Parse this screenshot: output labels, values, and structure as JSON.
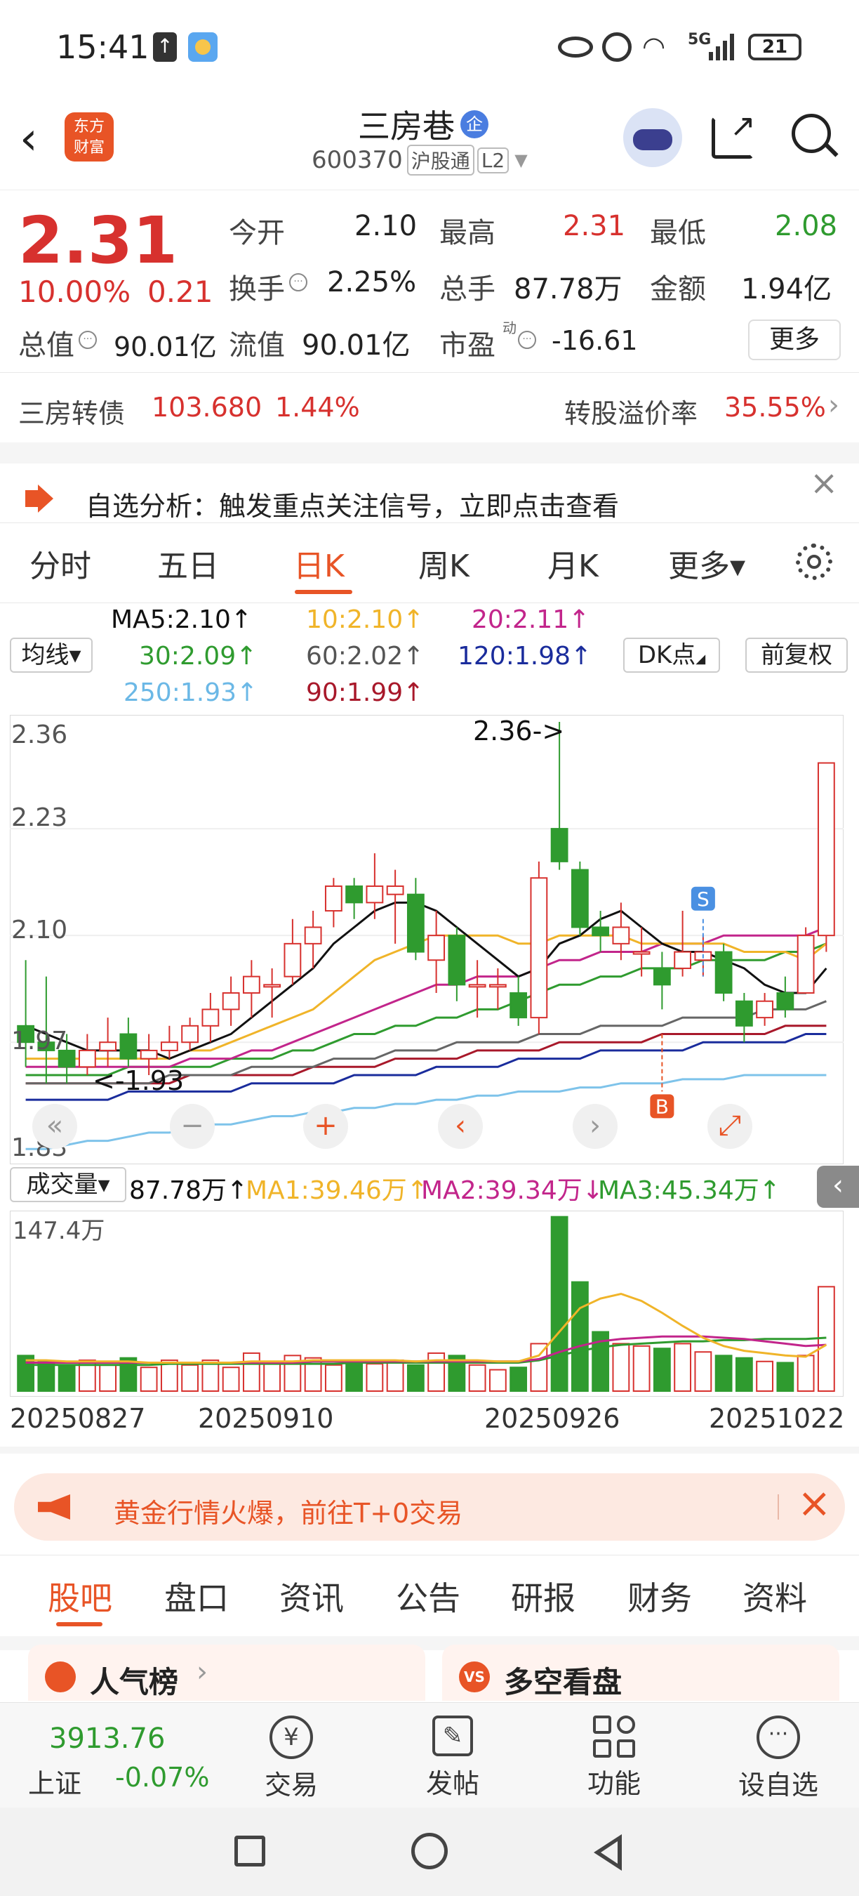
{
  "status_bar": {
    "time": "15:41",
    "battery": "21",
    "network": "5G"
  },
  "header": {
    "title": "三房巷",
    "badge": "企",
    "code": "600370",
    "exchange": "沪股通",
    "level": "L2",
    "logo_line1": "东方",
    "logo_line2": "财富"
  },
  "quote": {
    "price": "2.31",
    "change_pct": "10.00%",
    "change": "0.21",
    "open_label": "今开",
    "open": "2.10",
    "high_label": "最高",
    "high": "2.31",
    "low_label": "最低",
    "low": "2.08",
    "turnover_label": "换手",
    "turnover": "2.25%",
    "volume_label": "总手",
    "volume": "87.78万",
    "amount_label": "金额",
    "amount": "1.94亿",
    "mcap_label": "总值",
    "mcap": "90.01亿",
    "float_label": "流值",
    "float": "90.01亿",
    "pe_label": "市盈",
    "pe_sup": "动",
    "pe": "-16.61",
    "more_label": "更多"
  },
  "bond": {
    "name": "三房转债",
    "price": "103.680",
    "pct": "1.44%",
    "premium_label": "转股溢价率",
    "premium": "35.55%"
  },
  "notice": {
    "text": "自选分析：触发重点关注信号，立即点击查看"
  },
  "tabs": {
    "t1": "分时",
    "t2": "五日",
    "t3": "日K",
    "t4": "周K",
    "t5": "月K",
    "t6": "更多▾"
  },
  "ma": {
    "selector": "均线▾",
    "ma5": "MA5:2.10↑",
    "ma10": "10:2.10↑",
    "ma20": "20:2.11↑",
    "ma30": "30:2.09↑",
    "ma60": "60:2.02↑",
    "ma120": "120:1.98↑",
    "ma250": "250:1.93↑",
    "ma90": "90:1.99↑",
    "dk": "DK点",
    "adjust": "前复权"
  },
  "colors": {
    "up": "#d7312e",
    "down": "#2f9b2f",
    "ma5": "#111111",
    "ma10": "#f0b429",
    "ma20": "#c2258b",
    "ma30": "#2f9b2f",
    "ma60": "#666666",
    "ma120": "#1a2c9c",
    "ma250": "#7ec3ea",
    "ma90": "#a8182a"
  },
  "chart_labels": {
    "y_top": "2.36",
    "y_2": "2.23",
    "y_3": "2.10",
    "y_4": "1.97",
    "y_bottom": "1.83",
    "high_marker": "2.36->",
    "low_marker": "<-1.93",
    "signal_s": "S",
    "signal_b": "B"
  },
  "volume": {
    "selector": "成交量▾",
    "value": "87.78万↑",
    "ma1": "MA1:39.46万↑",
    "ma2": "MA2:39.34万↓",
    "ma3": "MA3:45.34万↑",
    "y_top": "147.4万",
    "dates": [
      "20250827",
      "20250910",
      "20250926",
      "20251022"
    ]
  },
  "chart_data": {
    "type": "candlestick",
    "title": "",
    "ylim": [
      1.83,
      2.36
    ],
    "candles": [
      {
        "o": 1.99,
        "c": 1.97,
        "h": 2.07,
        "l": 1.94
      },
      {
        "o": 1.97,
        "c": 1.96,
        "h": 2.05,
        "l": 1.92
      },
      {
        "o": 1.96,
        "c": 1.94,
        "h": 1.98,
        "l": 1.92
      },
      {
        "o": 1.94,
        "c": 1.96,
        "h": 1.98,
        "l": 1.93
      },
      {
        "o": 1.96,
        "c": 1.97,
        "h": 2.0,
        "l": 1.94
      },
      {
        "o": 1.98,
        "c": 1.95,
        "h": 2.0,
        "l": 1.94
      },
      {
        "o": 1.95,
        "c": 1.96,
        "h": 1.98,
        "l": 1.93
      },
      {
        "o": 1.96,
        "c": 1.97,
        "h": 1.99,
        "l": 1.95
      },
      {
        "o": 1.97,
        "c": 1.99,
        "h": 2.0,
        "l": 1.96
      },
      {
        "o": 1.99,
        "c": 2.01,
        "h": 2.03,
        "l": 1.97
      },
      {
        "o": 2.01,
        "c": 2.03,
        "h": 2.05,
        "l": 1.99
      },
      {
        "o": 2.03,
        "c": 2.05,
        "h": 2.07,
        "l": 2.0
      },
      {
        "o": 2.04,
        "c": 2.04,
        "h": 2.06,
        "l": 2.0
      },
      {
        "o": 2.05,
        "c": 2.09,
        "h": 2.12,
        "l": 2.04
      },
      {
        "o": 2.09,
        "c": 2.11,
        "h": 2.13,
        "l": 2.06
      },
      {
        "o": 2.13,
        "c": 2.16,
        "h": 2.17,
        "l": 2.11
      },
      {
        "o": 2.16,
        "c": 2.14,
        "h": 2.17,
        "l": 2.12
      },
      {
        "o": 2.14,
        "c": 2.16,
        "h": 2.2,
        "l": 2.12
      },
      {
        "o": 2.15,
        "c": 2.16,
        "h": 2.18,
        "l": 2.09
      },
      {
        "o": 2.15,
        "c": 2.08,
        "h": 2.17,
        "l": 2.07
      },
      {
        "o": 2.07,
        "c": 2.1,
        "h": 2.13,
        "l": 2.03
      },
      {
        "o": 2.1,
        "c": 2.04,
        "h": 2.11,
        "l": 2.02
      },
      {
        "o": 2.04,
        "c": 2.04,
        "h": 2.07,
        "l": 2.0
      },
      {
        "o": 2.04,
        "c": 2.04,
        "h": 2.06,
        "l": 2.01
      },
      {
        "o": 2.03,
        "c": 2.0,
        "h": 2.05,
        "l": 1.99
      },
      {
        "o": 2.0,
        "c": 2.17,
        "h": 2.19,
        "l": 1.98
      },
      {
        "o": 2.23,
        "c": 2.19,
        "h": 2.36,
        "l": 2.18
      },
      {
        "o": 2.18,
        "c": 2.11,
        "h": 2.19,
        "l": 2.1
      },
      {
        "o": 2.11,
        "c": 2.1,
        "h": 2.13,
        "l": 2.08
      },
      {
        "o": 2.09,
        "c": 2.11,
        "h": 2.14,
        "l": 2.07
      },
      {
        "o": 2.08,
        "c": 2.08,
        "h": 2.11,
        "l": 2.05
      },
      {
        "o": 2.06,
        "c": 2.04,
        "h": 2.08,
        "l": 2.01
      },
      {
        "o": 2.06,
        "c": 2.08,
        "h": 2.13,
        "l": 2.05
      },
      {
        "o": 2.07,
        "c": 2.08,
        "h": 2.1,
        "l": 2.05
      },
      {
        "o": 2.08,
        "c": 2.03,
        "h": 2.09,
        "l": 2.02
      },
      {
        "o": 2.02,
        "c": 1.99,
        "h": 2.03,
        "l": 1.97
      },
      {
        "o": 2.0,
        "c": 2.02,
        "h": 2.03,
        "l": 1.99
      },
      {
        "o": 2.03,
        "c": 2.01,
        "h": 2.05,
        "l": 2.0
      },
      {
        "o": 2.03,
        "c": 2.1,
        "h": 2.11,
        "l": 2.03
      },
      {
        "o": 2.1,
        "c": 2.31,
        "h": 2.31,
        "l": 2.08
      }
    ],
    "ma5": [
      1.99,
      1.98,
      1.97,
      1.96,
      1.96,
      1.96,
      1.96,
      1.95,
      1.96,
      1.97,
      1.98,
      2.0,
      2.02,
      2.04,
      2.06,
      2.09,
      2.11,
      2.13,
      2.14,
      2.14,
      2.13,
      2.11,
      2.09,
      2.07,
      2.05,
      2.06,
      2.09,
      2.1,
      2.12,
      2.13,
      2.11,
      2.09,
      2.08,
      2.08,
      2.07,
      2.06,
      2.04,
      2.03,
      2.03,
      2.06
    ],
    "ma10": [
      1.95,
      1.95,
      1.95,
      1.95,
      1.95,
      1.95,
      1.95,
      1.95,
      1.96,
      1.96,
      1.97,
      1.98,
      1.99,
      2.0,
      2.01,
      2.03,
      2.05,
      2.07,
      2.08,
      2.09,
      2.1,
      2.1,
      2.1,
      2.1,
      2.09,
      2.09,
      2.1,
      2.1,
      2.1,
      2.1,
      2.09,
      2.09,
      2.09,
      2.09,
      2.09,
      2.08,
      2.08,
      2.08,
      2.07,
      2.09
    ],
    "ma20": [
      1.94,
      1.94,
      1.94,
      1.94,
      1.94,
      1.94,
      1.94,
      1.94,
      1.95,
      1.95,
      1.95,
      1.96,
      1.96,
      1.97,
      1.98,
      1.99,
      2.0,
      2.01,
      2.02,
      2.03,
      2.04,
      2.04,
      2.05,
      2.05,
      2.05,
      2.06,
      2.07,
      2.07,
      2.08,
      2.08,
      2.08,
      2.09,
      2.09,
      2.09,
      2.1,
      2.1,
      2.1,
      2.1,
      2.1,
      2.11
    ],
    "ma30": [
      1.93,
      1.93,
      1.93,
      1.93,
      1.93,
      1.94,
      1.94,
      1.94,
      1.94,
      1.94,
      1.95,
      1.95,
      1.95,
      1.96,
      1.96,
      1.97,
      1.98,
      1.98,
      1.99,
      1.99,
      2.0,
      2.0,
      2.01,
      2.01,
      2.02,
      2.03,
      2.04,
      2.04,
      2.05,
      2.05,
      2.06,
      2.06,
      2.06,
      2.07,
      2.07,
      2.07,
      2.07,
      2.08,
      2.08,
      2.09
    ],
    "ma60": [
      1.92,
      1.92,
      1.92,
      1.92,
      1.92,
      1.92,
      1.92,
      1.93,
      1.93,
      1.93,
      1.93,
      1.94,
      1.94,
      1.94,
      1.94,
      1.95,
      1.95,
      1.95,
      1.96,
      1.96,
      1.96,
      1.97,
      1.97,
      1.97,
      1.97,
      1.98,
      1.98,
      1.98,
      1.99,
      1.99,
      1.99,
      1.99,
      2.0,
      2.0,
      2.0,
      2.0,
      2.01,
      2.01,
      2.01,
      2.02
    ],
    "ma90": [
      1.92,
      1.92,
      1.92,
      1.92,
      1.92,
      1.92,
      1.92,
      1.92,
      1.93,
      1.93,
      1.93,
      1.93,
      1.93,
      1.93,
      1.94,
      1.94,
      1.94,
      1.94,
      1.95,
      1.95,
      1.95,
      1.95,
      1.96,
      1.96,
      1.96,
      1.96,
      1.97,
      1.97,
      1.97,
      1.97,
      1.97,
      1.98,
      1.98,
      1.98,
      1.98,
      1.98,
      1.98,
      1.99,
      1.99,
      1.99
    ],
    "ma120": [
      1.9,
      1.9,
      1.9,
      1.9,
      1.9,
      1.91,
      1.91,
      1.91,
      1.91,
      1.91,
      1.91,
      1.92,
      1.92,
      1.92,
      1.92,
      1.92,
      1.93,
      1.93,
      1.93,
      1.93,
      1.94,
      1.94,
      1.94,
      1.94,
      1.95,
      1.95,
      1.95,
      1.95,
      1.96,
      1.96,
      1.96,
      1.96,
      1.96,
      1.97,
      1.97,
      1.97,
      1.97,
      1.97,
      1.98,
      1.98
    ],
    "ma250": [
      1.84,
      1.84,
      1.845,
      1.85,
      1.85,
      1.855,
      1.86,
      1.86,
      1.865,
      1.87,
      1.87,
      1.875,
      1.88,
      1.88,
      1.885,
      1.885,
      1.89,
      1.89,
      1.895,
      1.895,
      1.9,
      1.9,
      1.905,
      1.905,
      1.91,
      1.91,
      1.91,
      1.915,
      1.915,
      1.92,
      1.92,
      1.92,
      1.925,
      1.925,
      1.925,
      1.93,
      1.93,
      1.93,
      1.93,
      1.93
    ],
    "volumes": [
      30,
      25,
      22,
      26,
      22,
      28,
      20,
      26,
      22,
      26,
      20,
      32,
      24,
      30,
      28,
      22,
      26,
      23,
      26,
      22,
      32,
      30,
      22,
      18,
      20,
      40,
      147,
      92,
      50,
      40,
      38,
      36,
      40,
      33,
      30,
      28,
      25,
      24,
      30,
      88
    ],
    "vol_ylim": [
      0,
      147.4
    ],
    "vol_ma1": [
      26,
      26,
      25,
      25,
      25,
      25,
      24,
      24,
      24,
      24,
      24,
      25,
      25,
      25,
      26,
      26,
      26,
      26,
      26,
      25,
      26,
      26,
      26,
      25,
      25,
      30,
      50,
      70,
      78,
      82,
      76,
      66,
      55,
      45,
      38,
      34,
      32,
      30,
      29,
      39
    ],
    "vol_ma2": [
      24,
      24,
      24,
      24,
      24,
      24,
      24,
      24,
      24,
      24,
      24,
      24,
      24,
      24,
      25,
      25,
      25,
      25,
      25,
      25,
      25,
      25,
      25,
      25,
      25,
      27,
      33,
      38,
      42,
      44,
      45,
      46,
      46,
      46,
      45,
      44,
      42,
      40,
      38,
      39
    ],
    "vol_ma3": [
      22,
      22,
      22,
      22,
      22,
      22,
      22,
      23,
      23,
      23,
      23,
      23,
      23,
      23,
      23,
      23,
      24,
      24,
      24,
      24,
      24,
      24,
      24,
      24,
      24,
      26,
      30,
      34,
      37,
      39,
      40,
      41,
      42,
      42,
      43,
      43,
      44,
      44,
      44,
      45
    ]
  },
  "ad": {
    "text": "黄金行情火爆，前往T+0交易"
  },
  "section_tabs": {
    "s1": "股吧",
    "s2": "盘口",
    "s3": "资讯",
    "s4": "公告",
    "s5": "研报",
    "s6": "财务",
    "s7": "资料"
  },
  "cards": {
    "c1": "人气榜",
    "c2": "多空看盘"
  },
  "bottom_bar": {
    "index_value": "3913.76",
    "index_name": "上证",
    "index_pct": "-0.07%",
    "b1": "交易",
    "b2": "发帖",
    "b3": "功能",
    "b4": "设自选"
  }
}
